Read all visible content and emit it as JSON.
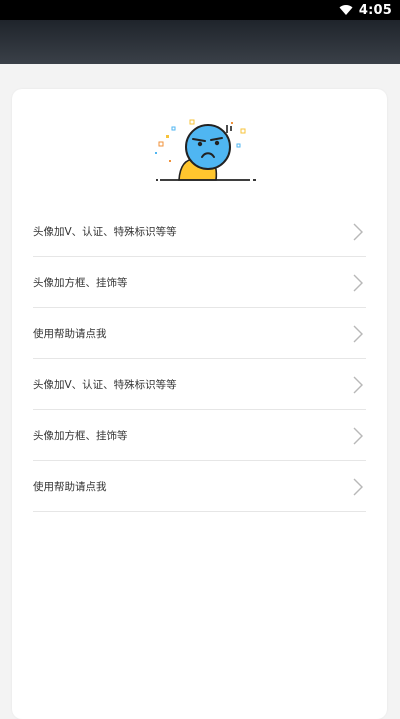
{
  "status_bar": {
    "time": "4:05",
    "wifi_icon": "wifi-icon"
  },
  "menu": {
    "items": [
      {
        "label": "头像加V、认证、特殊标识等等"
      },
      {
        "label": "头像加方框、挂饰等"
      },
      {
        "label": "使用帮助请点我"
      },
      {
        "label": "头像加V、认证、特殊标识等等"
      },
      {
        "label": "头像加方框、挂饰等"
      },
      {
        "label": "使用帮助请点我"
      }
    ],
    "chevron_icon": "chevron-right-icon"
  },
  "illustration": {
    "icon": "grumpy-face-illustration"
  },
  "colors": {
    "status_bar": "#000000",
    "toolbar": "#2c3138",
    "face_blue": "#4fb6f2",
    "body_yellow": "#ffc62e",
    "divider": "#e6e6e6",
    "chevron": "#b8b8b8"
  }
}
